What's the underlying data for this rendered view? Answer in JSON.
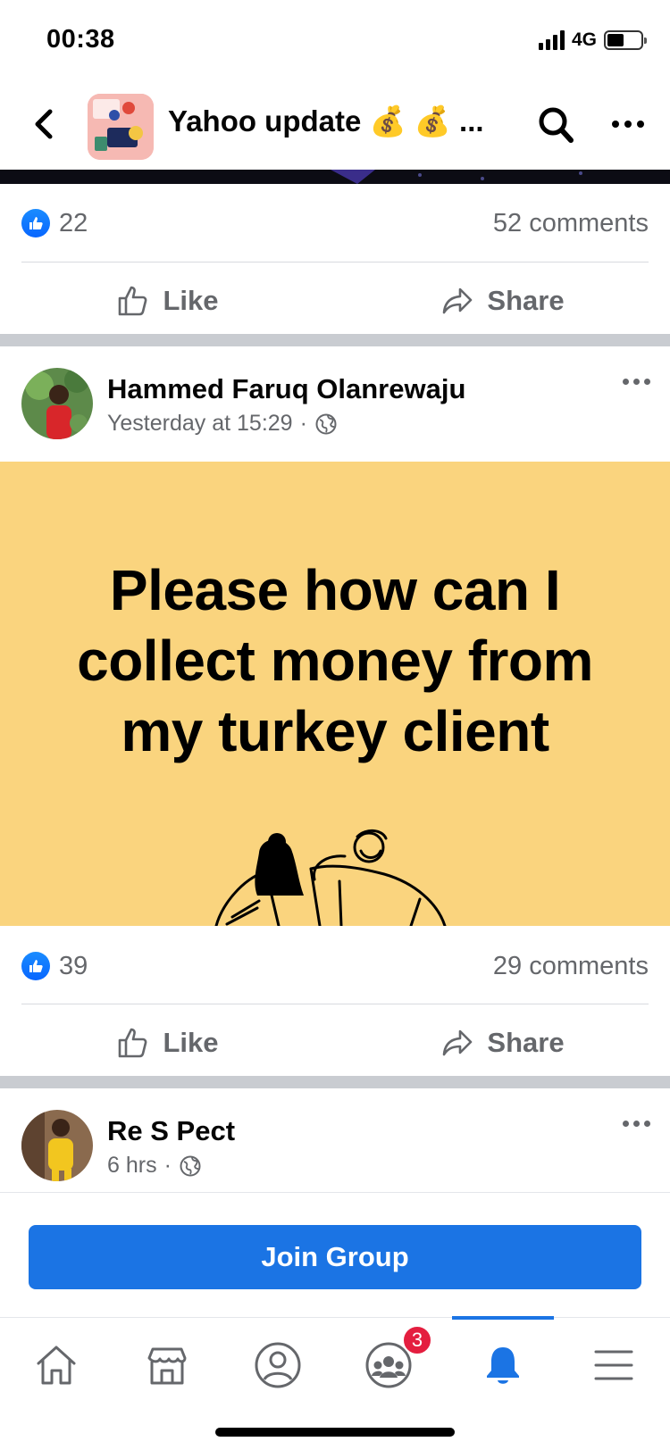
{
  "status_bar": {
    "time": "00:38",
    "network": "4G"
  },
  "header": {
    "title": "Yahoo update 💰 💰 ..."
  },
  "posts": [
    {
      "likes": "22",
      "comments": "52 comments",
      "like_label": "Like",
      "share_label": "Share"
    },
    {
      "author": "Hammed Faruq Olanrewaju",
      "time": "Yesterday at 15:29",
      "separator": "·",
      "text": "Please how can I collect money from my turkey client",
      "likes": "39",
      "comments": "29 comments",
      "like_label": "Like",
      "share_label": "Share"
    },
    {
      "author": "Re S Pect",
      "time": "6 hrs",
      "separator": "·"
    }
  ],
  "join_button": "Join Group",
  "tab_bar": {
    "tabs": [
      "home-icon",
      "marketplace-icon",
      "profile-icon",
      "groups-icon",
      "notifications-icon",
      "menu-icon"
    ],
    "active": "notifications-icon",
    "groups_badge": "3"
  },
  "colors": {
    "accent": "#1b74e4",
    "post_background": "#fad47e",
    "badge": "#e41e3f",
    "separator": "#c9ccd1"
  }
}
